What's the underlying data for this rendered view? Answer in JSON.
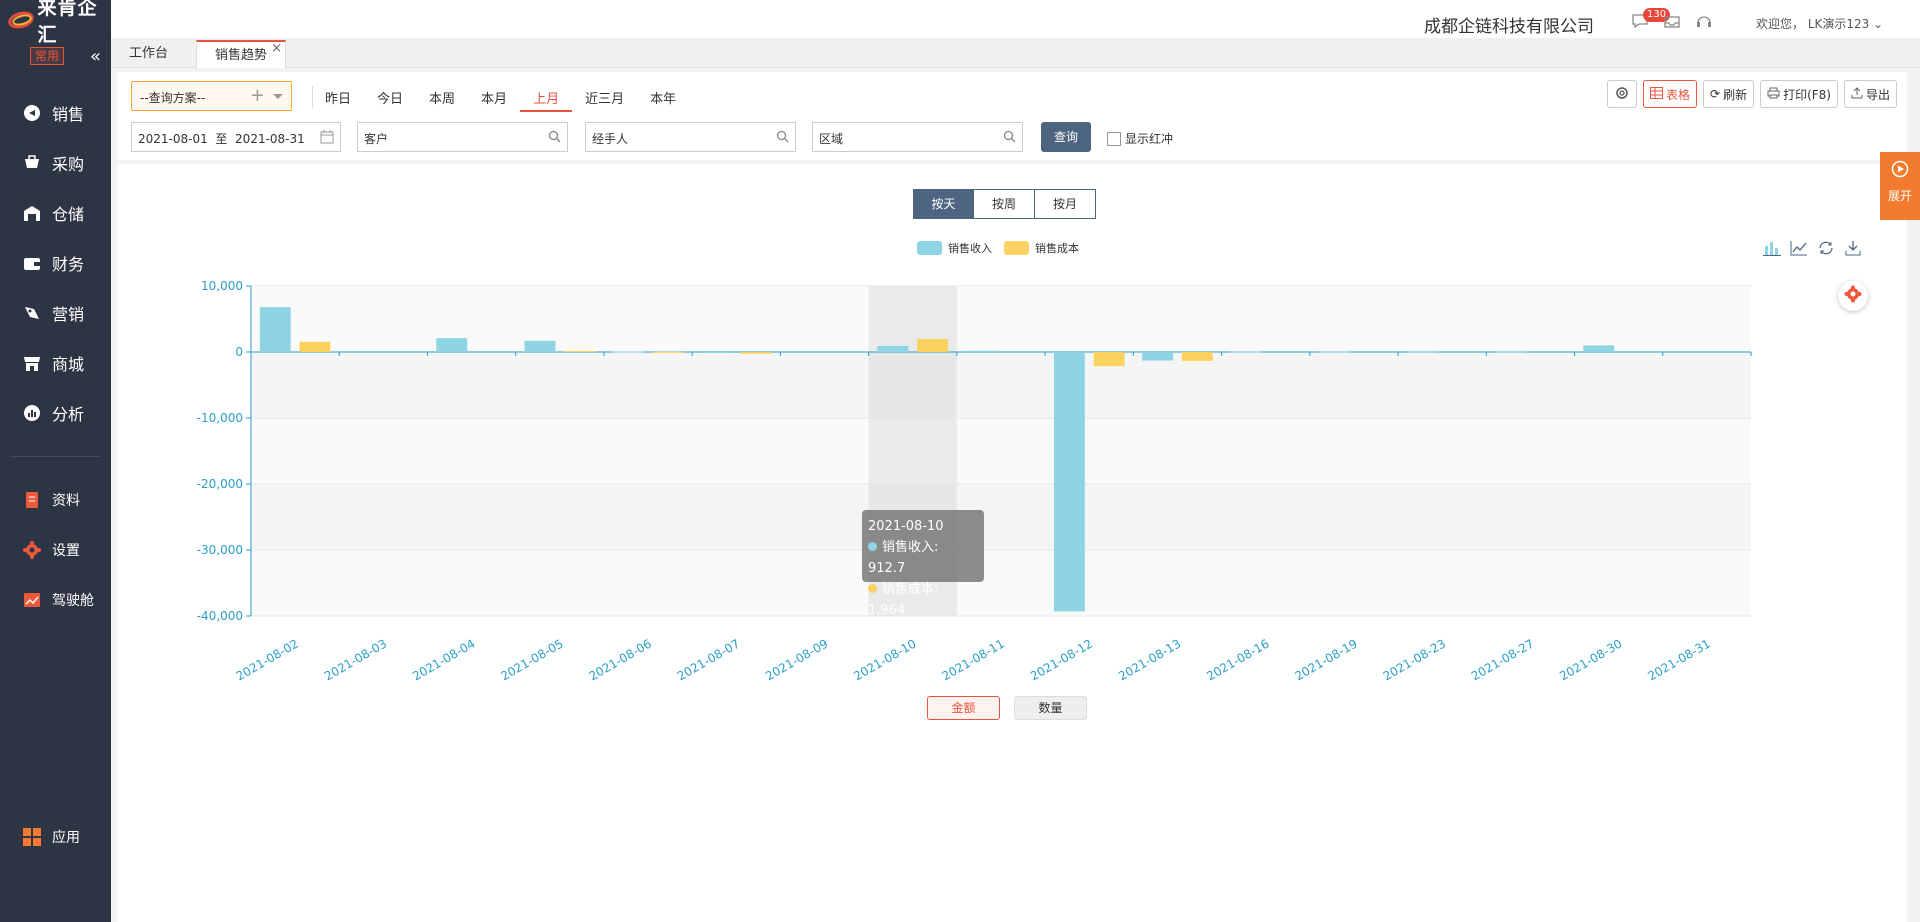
{
  "app": {
    "logo_text": "来肯企汇",
    "common_tag": "常用"
  },
  "sidebar": {
    "items": [
      {
        "label": "销售",
        "icon": "sales-icon"
      },
      {
        "label": "采购",
        "icon": "purchase-icon"
      },
      {
        "label": "仓储",
        "icon": "warehouse-icon"
      },
      {
        "label": "财务",
        "icon": "finance-icon"
      },
      {
        "label": "营销",
        "icon": "marketing-icon"
      },
      {
        "label": "商城",
        "icon": "store-icon"
      },
      {
        "label": "分析",
        "icon": "analysis-icon"
      }
    ],
    "secondary": [
      {
        "label": "资料",
        "icon": "data-icon"
      },
      {
        "label": "设置",
        "icon": "settings-icon"
      },
      {
        "label": "驾驶舱",
        "icon": "cockpit-icon"
      }
    ],
    "apps_label": "应用"
  },
  "header": {
    "company": "成都企链科技有限公司",
    "message_badge": "130",
    "welcome": "欢迎您，  LK演示123"
  },
  "tabs": [
    {
      "label": "工作台"
    },
    {
      "label": "销售趋势"
    }
  ],
  "toolbar": {
    "plan_placeholder": "--查询方案--",
    "quick_ranges": [
      "昨日",
      "今日",
      "本周",
      "本月",
      "上月",
      "近三月",
      "本年"
    ],
    "active_range": "上月",
    "settings_label": "",
    "table_label": "表格",
    "refresh_label": "刷新",
    "print_label": "打印(F8)",
    "export_label": "导出",
    "date_from": "2021-08-01",
    "date_sep": "至",
    "date_to": "2021-08-31",
    "customer_placeholder": "客户",
    "handler_placeholder": "经手人",
    "region_placeholder": "区域",
    "query_label": "查询",
    "show_reverse_label": "显示红冲"
  },
  "chart_view": {
    "period_buttons": [
      "按天",
      "按周",
      "按月"
    ],
    "active_period": "按天",
    "metric_buttons": [
      "金额",
      "数量"
    ],
    "active_metric": "金额"
  },
  "chart_data": {
    "type": "bar",
    "categories": [
      "2021-08-02",
      "2021-08-03",
      "2021-08-04",
      "2021-08-05",
      "2021-08-06",
      "2021-08-07",
      "2021-08-09",
      "2021-08-10",
      "2021-08-11",
      "2021-08-12",
      "2021-08-13",
      "2021-08-16",
      "2021-08-19",
      "2021-08-23",
      "2021-08-27",
      "2021-08-30",
      "2021-08-31"
    ],
    "series": [
      {
        "name": "销售收入",
        "color": "#8fd4e2",
        "values": [
          6800,
          0,
          2100,
          1700,
          60,
          -150,
          0,
          912.7,
          200,
          -39300,
          -1300,
          50,
          50,
          30,
          30,
          1000,
          0
        ]
      },
      {
        "name": "销售成本",
        "color": "#fbd25f",
        "values": [
          1550,
          0,
          0,
          150,
          20,
          -250,
          0,
          1964,
          0,
          -2150,
          -1350,
          0,
          0,
          0,
          0,
          0,
          0
        ]
      }
    ],
    "ylim": [
      -40000,
      10000
    ],
    "yticks": [
      "10,000",
      "0",
      "-10,000",
      "-20,000",
      "-30,000",
      "-40,000"
    ],
    "grid": true,
    "legend": "top-center",
    "tooltip": {
      "title": "2021-08-10",
      "rows": [
        "销售收入: 912.7",
        "销售成本: 1,964"
      ]
    }
  },
  "float": {
    "expand_label": "展开"
  }
}
